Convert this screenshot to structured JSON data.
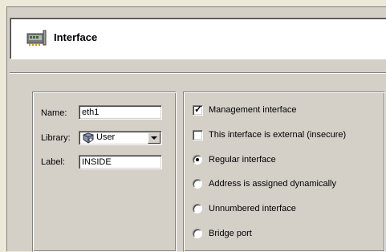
{
  "header": {
    "title": "Interface",
    "icon": "network-card-icon"
  },
  "form": {
    "name_label": "Name:",
    "name_value": "eth1",
    "library_label": "Library:",
    "library_value": "User",
    "library_icon": "user-library-icon",
    "label_label": "Label:",
    "label_value": "INSIDE"
  },
  "options": {
    "management": {
      "label": "Management interface",
      "checked": true
    },
    "external": {
      "label": "This interface is external (insecure)",
      "checked": false
    },
    "regular": {
      "label": "Regular interface",
      "selected": true
    },
    "dynamic": {
      "label": "Address is assigned dynamically",
      "selected": false
    },
    "unnumbered": {
      "label": "Unnumbered interface",
      "selected": false
    },
    "bridge": {
      "label": "Bridge port",
      "selected": false
    }
  },
  "colors": {
    "panel_bg": "#d4d0c8",
    "header_bg": "#ffffff",
    "shadow": "#808080"
  }
}
